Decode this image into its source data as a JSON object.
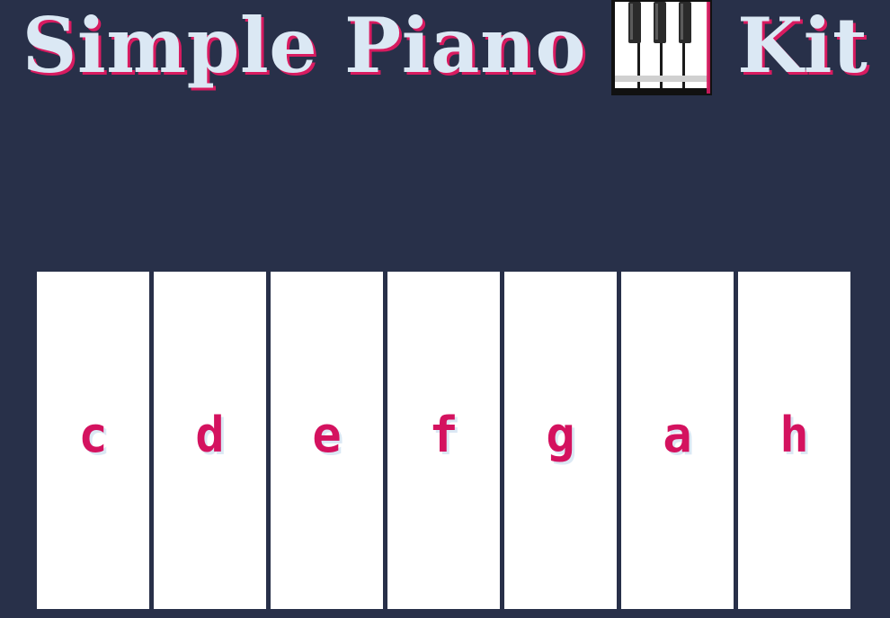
{
  "header": {
    "title_before_icon": "Simple Piano",
    "title_after_icon": "Kit",
    "icon": "piano-keys-icon"
  },
  "keyboard": {
    "keys": [
      {
        "label": "c"
      },
      {
        "label": "d"
      },
      {
        "label": "e"
      },
      {
        "label": "f"
      },
      {
        "label": "g"
      },
      {
        "label": "a"
      },
      {
        "label": "h"
      }
    ]
  },
  "colors": {
    "background": "#283049",
    "title_text": "#dbe8f4",
    "title_shadow": "#d81b60",
    "key_background": "#ffffff",
    "key_label": "#d4125f"
  }
}
